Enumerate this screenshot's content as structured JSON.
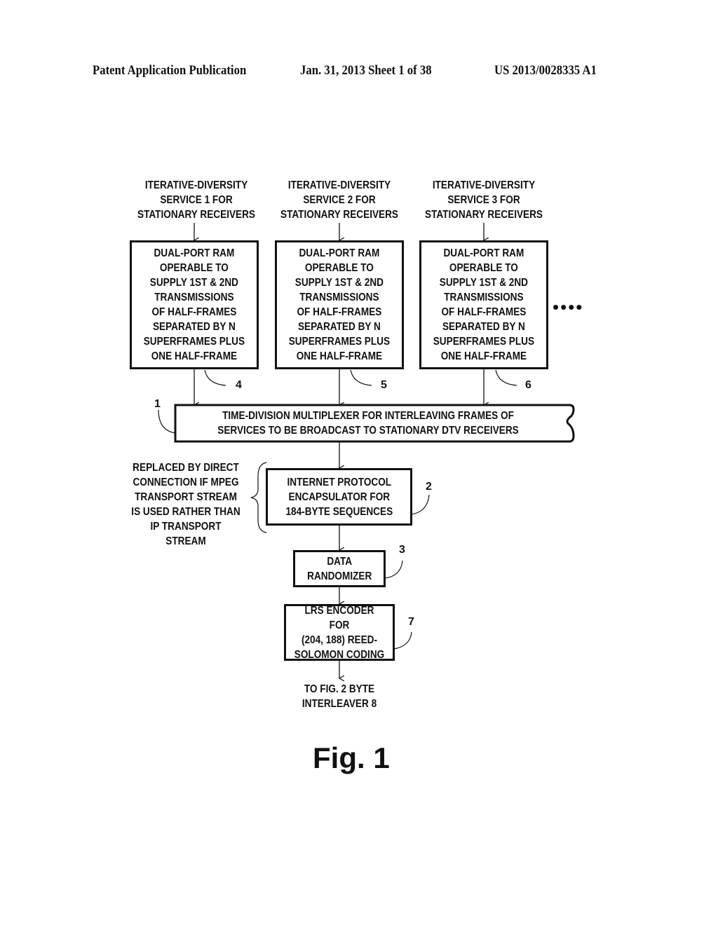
{
  "header": {
    "publication": "Patent Application Publication",
    "date_sheet": "Jan. 31, 2013  Sheet 1 of 38",
    "pub_number": "US 2013/0028335 A1"
  },
  "services": [
    {
      "input_label": "ITERATIVE-DIVERSITY\nSERVICE 1 FOR\nSTATIONARY RECEIVERS",
      "box_text": "DUAL-PORT RAM\nOPERABLE TO\nSUPPLY 1ST & 2ND\nTRANSMISSIONS\nOF HALF-FRAMES\nSEPARATED BY  N\nSUPERFRAMES PLUS\nONE HALF-FRAME",
      "ref": "4"
    },
    {
      "input_label": "ITERATIVE-DIVERSITY\nSERVICE 2 FOR\nSTATIONARY RECEIVERS",
      "box_text": "DUAL-PORT RAM\nOPERABLE TO\nSUPPLY 1ST & 2ND\nTRANSMISSIONS\nOF HALF-FRAMES\nSEPARATED BY  N\nSUPERFRAMES PLUS\nONE HALF-FRAME",
      "ref": "5"
    },
    {
      "input_label": "ITERATIVE-DIVERSITY\nSERVICE 3 FOR\nSTATIONARY RECEIVERS",
      "box_text": "DUAL-PORT RAM\nOPERABLE TO\nSUPPLY 1ST & 2ND\nTRANSMISSIONS\nOF HALF-FRAMES\nSEPARATED BY  N\nSUPERFRAMES PLUS\nONE HALF-FRAME",
      "ref": "6"
    }
  ],
  "continuation": "••••",
  "multiplexer": {
    "text": "TIME-DIVISION MULTIPLEXER FOR INTERLEAVING FRAMES OF\nSERVICES TO BE BROADCAST TO STATIONARY DTV RECEIVERS",
    "ref": "1"
  },
  "note": "REPLACED BY DIRECT\nCONNECTION IF MPEG\nTRANSPORT STREAM\nIS USED RATHER THAN\nIP TRANSPORT STREAM",
  "encapsulator": {
    "text": "INTERNET PROTOCOL\nENCAPSULATOR FOR\n184-BYTE SEQUENCES",
    "ref": "2"
  },
  "randomizer": {
    "text": "DATA\nRANDOMIZER",
    "ref": "3"
  },
  "encoder": {
    "text": "LRS ENCODER FOR\n(204, 188) REED-\nSOLOMON CODING",
    "ref": "7"
  },
  "output_label": "TO FIG. 2 BYTE\nINTERLEAVER 8",
  "figure_label": "Fig. 1"
}
